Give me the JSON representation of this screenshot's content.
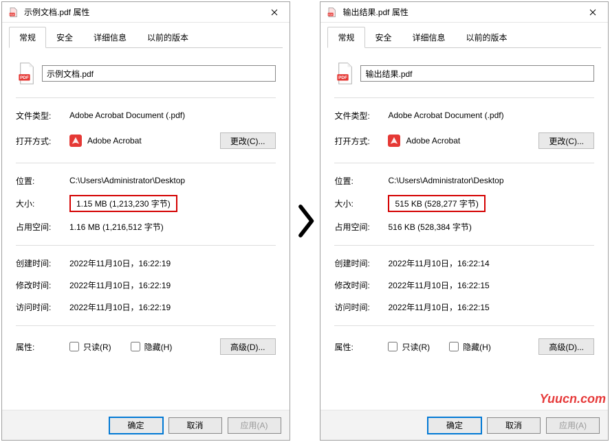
{
  "watermark": "Yuucn.com",
  "arrow_glyph": "❯",
  "left": {
    "title": "示例文档.pdf 属性",
    "tabs": {
      "t0": "常规",
      "t1": "安全",
      "t2": "详细信息",
      "t3": "以前的版本"
    },
    "filename": "示例文档.pdf",
    "labels": {
      "filetype": "文件类型:",
      "openwith": "打开方式:",
      "location": "位置:",
      "size": "大小:",
      "sizedisk": "占用空间:",
      "created": "创建时间:",
      "modified": "修改时间:",
      "accessed": "访问时间:",
      "attrs": "属性:"
    },
    "values": {
      "filetype": "Adobe Acrobat Document (.pdf)",
      "openwith": "Adobe Acrobat",
      "change_btn": "更改(C)...",
      "location": "C:\\Users\\Administrator\\Desktop",
      "size": "1.15 MB (1,213,230 字节)",
      "sizedisk": "1.16 MB (1,216,512 字节)",
      "created": "2022年11月10日，16:22:19",
      "modified": "2022年11月10日，16:22:19",
      "accessed": "2022年11月10日，16:22:19",
      "readonly": "只读(R)",
      "hidden": "隐藏(H)",
      "advanced_btn": "高级(D)..."
    },
    "buttons": {
      "ok": "确定",
      "cancel": "取消",
      "apply": "应用(A)"
    }
  },
  "right": {
    "title": "输出结果.pdf 属性",
    "tabs": {
      "t0": "常规",
      "t1": "安全",
      "t2": "详细信息",
      "t3": "以前的版本"
    },
    "filename": "输出结果.pdf",
    "labels": {
      "filetype": "文件类型:",
      "openwith": "打开方式:",
      "location": "位置:",
      "size": "大小:",
      "sizedisk": "占用空间:",
      "created": "创建时间:",
      "modified": "修改时间:",
      "accessed": "访问时间:",
      "attrs": "属性:"
    },
    "values": {
      "filetype": "Adobe Acrobat Document (.pdf)",
      "openwith": "Adobe Acrobat",
      "change_btn": "更改(C)...",
      "location": "C:\\Users\\Administrator\\Desktop",
      "size": "515 KB (528,277 字节)",
      "sizedisk": "516 KB (528,384 字节)",
      "created": "2022年11月10日，16:22:14",
      "modified": "2022年11月10日，16:22:15",
      "accessed": "2022年11月10日，16:22:15",
      "readonly": "只读(R)",
      "hidden": "隐藏(H)",
      "advanced_btn": "高级(D)..."
    },
    "buttons": {
      "ok": "确定",
      "cancel": "取消",
      "apply": "应用(A)"
    }
  }
}
